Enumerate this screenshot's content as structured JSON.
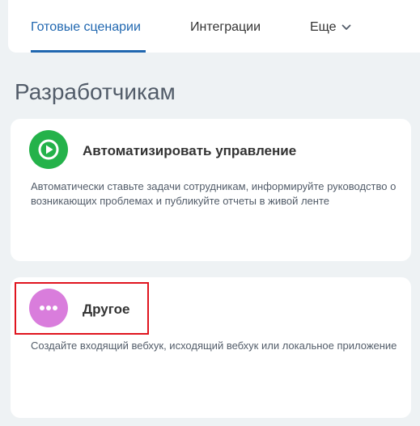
{
  "tabs": [
    {
      "label": "Готовые сценарии",
      "active": true
    },
    {
      "label": "Интеграции",
      "active": false
    },
    {
      "label": "Еще",
      "active": false,
      "icon": "chevron-down-icon"
    }
  ],
  "section": {
    "title": "Разработчикам"
  },
  "cards": [
    {
      "icon": "play-circle-icon",
      "icon_color": "#24b24a",
      "title": "Автоматизировать управление",
      "description": "Автоматически ставьте задачи сотрудникам, информируйте руководство о возникающих проблемах и публикуйте отчеты в живой ленте"
    },
    {
      "icon": "more-dots-icon",
      "icon_color": "#d97ddc",
      "title": "Другое",
      "description": "Создайте входящий вебхук, исходящий вебхук или локальное приложение",
      "highlighted": true
    }
  ],
  "colors": {
    "accent": "#2067b0",
    "highlight": "#e0141e",
    "background": "#eef2f4"
  }
}
